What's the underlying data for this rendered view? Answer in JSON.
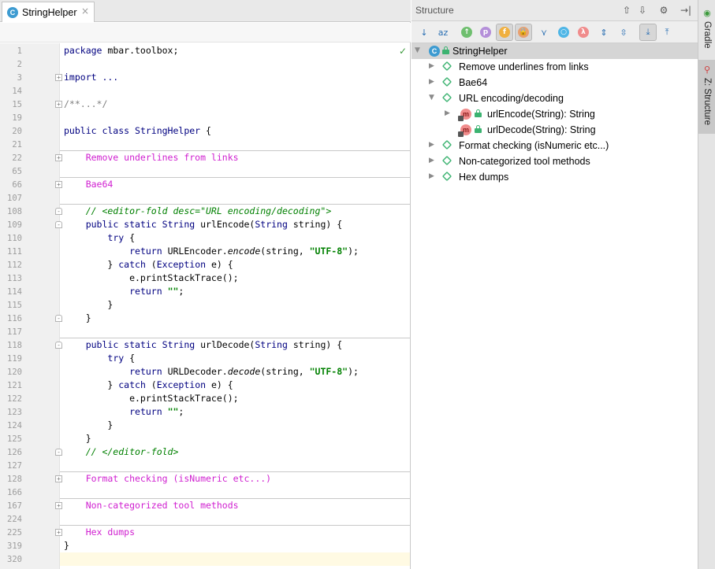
{
  "editor": {
    "tab": {
      "icon_letter": "C",
      "label": "StringHelper",
      "close": "×"
    },
    "lines": [
      {
        "num": "1",
        "type": "package",
        "kw": "package",
        "rest": " mbar.toolbox;"
      },
      {
        "num": "2"
      },
      {
        "num": "3",
        "type": "import",
        "fold": "+",
        "text": "import ..."
      },
      {
        "num": "14"
      },
      {
        "num": "15",
        "type": "comment",
        "fold": "+",
        "text": "/**...*/"
      },
      {
        "num": "19"
      },
      {
        "num": "20",
        "type": "classdecl",
        "kw": "public class",
        "name": " StringHelper",
        "rest": " {"
      },
      {
        "num": "21"
      },
      {
        "num": "22",
        "type": "region",
        "fold": "+",
        "text": "    Remove underlines from links"
      },
      {
        "num": "65"
      },
      {
        "num": "66",
        "type": "region",
        "fold": "+",
        "text": "    Bae64"
      },
      {
        "num": "107"
      },
      {
        "num": "108",
        "type": "foldcomment",
        "fold": "-",
        "text": "    // <editor-fold desc=\"URL encoding/decoding\">"
      },
      {
        "num": "109",
        "type": "method",
        "fold": "-",
        "indent": "    ",
        "kw": "public static",
        "t1": " String",
        "name": " urlEncode(",
        "t2": "String",
        "rest": " string) {"
      },
      {
        "num": "110",
        "type": "kwline",
        "indent": "        ",
        "kw": "try",
        "rest": " {"
      },
      {
        "num": "111",
        "type": "ret",
        "indent": "            ",
        "kw": "return",
        "cls": " URLEncoder.",
        "call": "encode",
        "pre": "(string, ",
        "str": "\"UTF-8\"",
        "post": ");"
      },
      {
        "num": "112",
        "type": "catch",
        "indent": "        ",
        "open": "} ",
        "kw": "catch",
        "mid": " (",
        "cls": "Exception",
        "rest": " e) {"
      },
      {
        "num": "113",
        "type": "plain",
        "text": "            e.printStackTrace();"
      },
      {
        "num": "114",
        "type": "retstr",
        "indent": "            ",
        "kw": "return",
        "str": " \"\"",
        "rest": ";"
      },
      {
        "num": "115",
        "type": "plain",
        "text": "        }"
      },
      {
        "num": "116",
        "type": "plain",
        "fold": "-",
        "text": "    }"
      },
      {
        "num": "117"
      },
      {
        "num": "118",
        "type": "method",
        "fold": "-",
        "indent": "    ",
        "kw": "public static",
        "t1": " String",
        "name": " urlDecode(",
        "t2": "String",
        "rest": " string) {"
      },
      {
        "num": "119",
        "type": "kwline",
        "indent": "        ",
        "kw": "try",
        "rest": " {"
      },
      {
        "num": "120",
        "type": "ret",
        "indent": "            ",
        "kw": "return",
        "cls": " URLDecoder.",
        "call": "decode",
        "pre": "(string, ",
        "str": "\"UTF-8\"",
        "post": ");"
      },
      {
        "num": "121",
        "type": "catch",
        "indent": "        ",
        "open": "} ",
        "kw": "catch",
        "mid": " (",
        "cls": "Exception",
        "rest": " e) {"
      },
      {
        "num": "122",
        "type": "plain",
        "text": "            e.printStackTrace();"
      },
      {
        "num": "123",
        "type": "retstr",
        "indent": "            ",
        "kw": "return",
        "str": " \"\"",
        "rest": ";"
      },
      {
        "num": "124",
        "type": "plain",
        "text": "        }"
      },
      {
        "num": "125",
        "type": "plain",
        "text": "    }"
      },
      {
        "num": "126",
        "type": "foldcomment",
        "fold": "-",
        "text": "    // </editor-fold>"
      },
      {
        "num": "127"
      },
      {
        "num": "128",
        "type": "region",
        "fold": "+",
        "text": "    Format checking (isNumeric etc...)"
      },
      {
        "num": "166"
      },
      {
        "num": "167",
        "type": "region",
        "fold": "+",
        "text": "    Non-categorized tool methods"
      },
      {
        "num": "224"
      },
      {
        "num": "225",
        "type": "region",
        "fold": "+",
        "text": "    Hex dumps"
      },
      {
        "num": "319",
        "type": "plain",
        "text": "}"
      },
      {
        "num": "320"
      }
    ]
  },
  "structure": {
    "title": "Structure",
    "header_icons": [
      "expand-all-icon",
      "collapse-all-icon",
      "settings-icon",
      "hide-icon"
    ],
    "toolbar": [
      {
        "name": "sort-by-visibility-icon",
        "glyph": "↓",
        "active": false
      },
      {
        "name": "sort-alphabetically-icon",
        "glyph": "az",
        "active": false
      },
      {
        "name": "show-inherited-icon",
        "glyph": "↑",
        "active": false
      },
      {
        "name": "show-properties-icon",
        "glyph": "p",
        "active": false
      },
      {
        "name": "show-fields-icon",
        "glyph": "f",
        "active": true
      },
      {
        "name": "show-non-public-icon",
        "glyph": "🔒",
        "active": true
      },
      {
        "name": "group-by-hierarchy-icon",
        "glyph": "⋎",
        "active": false
      },
      {
        "name": "show-anonymous-icon",
        "glyph": "○",
        "active": false
      },
      {
        "name": "show-lambdas-icon",
        "glyph": "λ",
        "active": false
      },
      {
        "name": "expand-icon",
        "glyph": "⇕",
        "active": false
      },
      {
        "name": "collapse-icon",
        "glyph": "⇳",
        "active": false
      },
      {
        "name": "autoscroll-to-source-icon",
        "glyph": "⤓",
        "active": true
      },
      {
        "name": "autoscroll-from-source-icon",
        "glyph": "⤒",
        "active": false
      }
    ],
    "tree": [
      {
        "level": 0,
        "kind": "class",
        "label": "StringHelper",
        "arrow": "▼",
        "icon_letter": "C",
        "selected": true
      },
      {
        "level": 1,
        "kind": "region",
        "label": "Remove underlines from links",
        "arrow": "▶"
      },
      {
        "level": 1,
        "kind": "region",
        "label": "Bae64",
        "arrow": "▶"
      },
      {
        "level": 1,
        "kind": "region",
        "label": "URL encoding/decoding",
        "arrow": "▼"
      },
      {
        "level": 2,
        "kind": "method",
        "label": "urlEncode(String): String",
        "arrow": "▶",
        "icon_letter": "m"
      },
      {
        "level": 2,
        "kind": "method",
        "label": "urlDecode(String): String",
        "arrow": "",
        "icon_letter": "m"
      },
      {
        "level": 1,
        "kind": "region",
        "label": "Format checking (isNumeric etc...)",
        "arrow": "▶"
      },
      {
        "level": 1,
        "kind": "region",
        "label": "Non-categorized tool methods",
        "arrow": "▶"
      },
      {
        "level": 1,
        "kind": "region",
        "label": "Hex dumps",
        "arrow": "▶"
      }
    ]
  },
  "tool_strip": {
    "gradle": "Gradle",
    "structure": "Z: Structure"
  },
  "colors": {
    "keyword": "#000080",
    "string": "#008000",
    "region": "#d020d0",
    "accent": "#3d9bd1"
  }
}
